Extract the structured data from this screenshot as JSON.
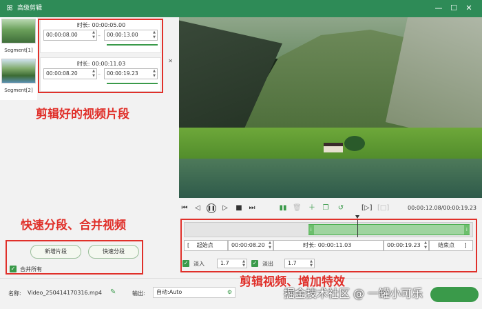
{
  "window": {
    "title": "高级剪辑",
    "minimize": "—",
    "maximize": "☐",
    "close": "✕"
  },
  "segments": {
    "thumbs": [
      {
        "label": "Segment[1]"
      },
      {
        "label": "Segment[2]"
      }
    ],
    "cards": [
      {
        "duration_label": "时长:",
        "duration": "00:00:05.00",
        "start": "00:00:08.00",
        "end": "00:00:13.00"
      },
      {
        "duration_label": "时长:",
        "duration": "00:00:11.03",
        "start": "00:00:08.20",
        "end": "00:00:19.23"
      }
    ],
    "separator": "–",
    "close_symbol": "✕"
  },
  "annotations": {
    "segments_note": "剪辑好的视频片段",
    "split_note": "快速分段、合并视频",
    "edit_note": "剪辑视频、增加特效"
  },
  "split": {
    "add_segment": "新增片段",
    "quick_split": "快速分段",
    "merge_all": "合并所有",
    "merge_all_checked": true
  },
  "player": {
    "time_readout": "00:00:12.08/00:00:19.23",
    "progress": 0.6
  },
  "timeline": {
    "range_start_fraction": 0.43,
    "range_end_fraction": 0.99,
    "playhead_fraction": 0.6
  },
  "trim": {
    "start_point": "起始点",
    "start_time": "00:00:08.20",
    "duration_label": "时长:",
    "duration": "00:00:11.03",
    "end_time": "00:00:19.23",
    "end_point": "结束点",
    "bracket_left": "[",
    "bracket_right": "]"
  },
  "fade": {
    "fade_in_label": "淡入",
    "fade_in_value": "1.7",
    "fade_out_label": "淡出",
    "fade_out_value": "1.7"
  },
  "status": {
    "name_label": "名称:",
    "filename": "Video_250414170316.mp4",
    "output_label": "输出:",
    "output_value": "自动:Auto",
    "watermark": "掘金技术社区 @ 一罐小可乐"
  },
  "colors": {
    "accent": "#2e8b57",
    "annotation_red": "#e0302a",
    "timeline_green": "#9fd49f"
  }
}
